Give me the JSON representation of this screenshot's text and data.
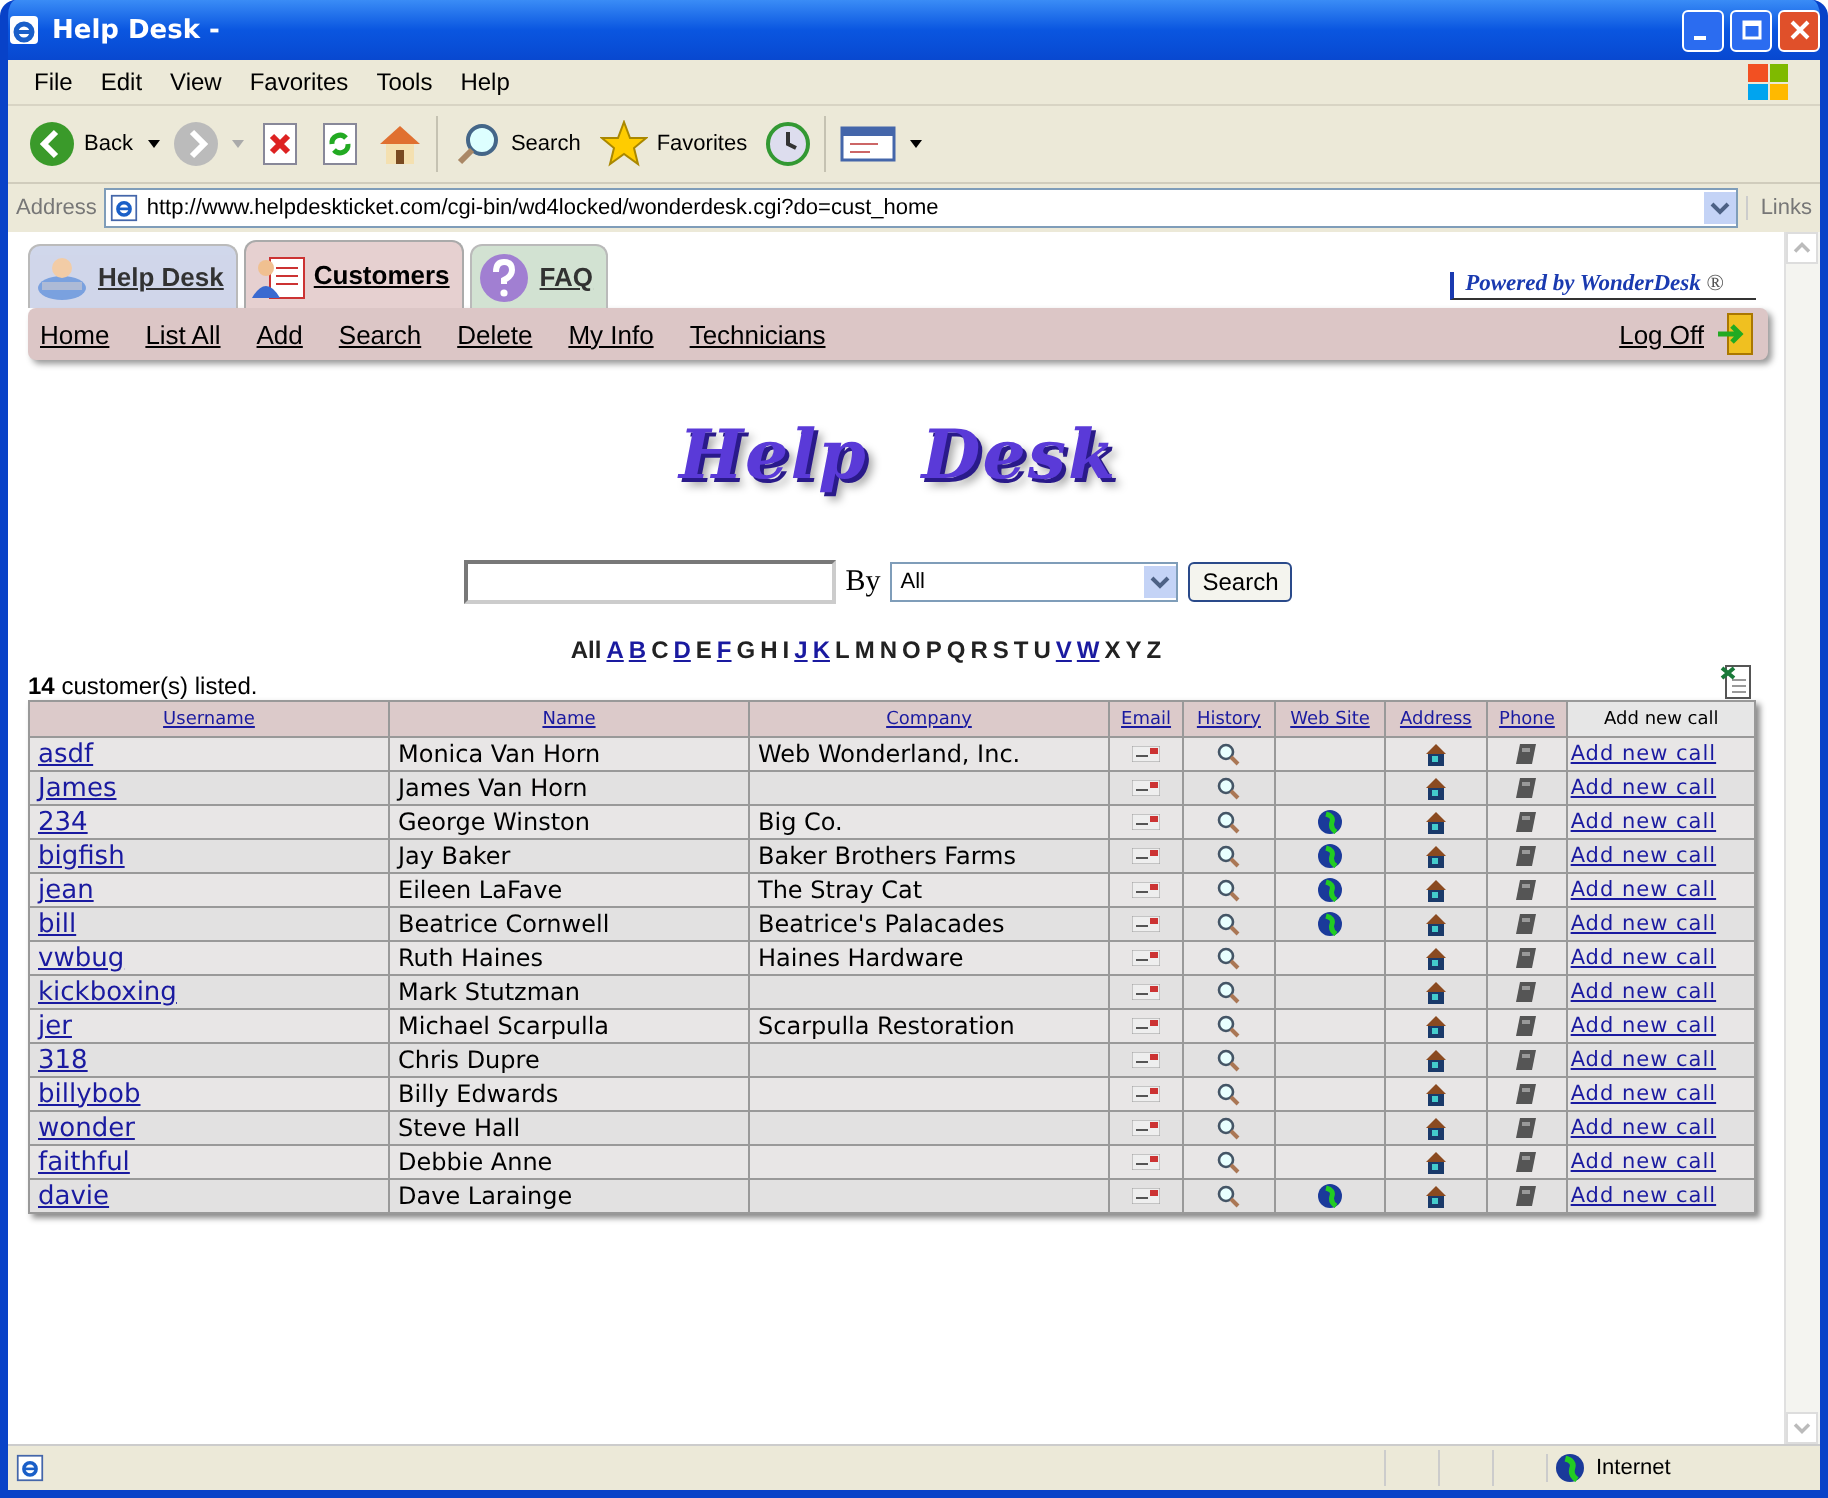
{
  "window": {
    "title": "Help Desk -"
  },
  "menu": [
    "File",
    "Edit",
    "View",
    "Favorites",
    "Tools",
    "Help"
  ],
  "toolbar": {
    "back": "Back",
    "search": "Search",
    "favorites": "Favorites"
  },
  "address": {
    "label": "Address",
    "url": "http://www.helpdeskticket.com/cgi-bin/wd4locked/wonderdesk.cgi?do=cust_home",
    "links": "Links"
  },
  "tabs": [
    {
      "label": "Help Desk",
      "selected": false,
      "kind": "helpdesk"
    },
    {
      "label": "Customers",
      "selected": true,
      "kind": "customers"
    },
    {
      "label": "FAQ",
      "selected": false,
      "kind": "faq"
    }
  ],
  "powered_by": "Powered by WonderDesk",
  "powered_mark": "®",
  "nav": [
    "Home",
    "List All",
    "Add",
    "Search",
    "Delete",
    "My Info",
    "Technicians"
  ],
  "log_off": "Log Off",
  "logo": "Help Desk",
  "search": {
    "by_label": "By",
    "by_value": "All",
    "button": "Search"
  },
  "alphabet": [
    {
      "letter": "All",
      "link": false
    },
    {
      "letter": "A",
      "link": true
    },
    {
      "letter": "B",
      "link": true
    },
    {
      "letter": "C",
      "link": false
    },
    {
      "letter": "D",
      "link": true
    },
    {
      "letter": "E",
      "link": false
    },
    {
      "letter": "F",
      "link": true
    },
    {
      "letter": "G",
      "link": false
    },
    {
      "letter": "H",
      "link": false
    },
    {
      "letter": "I",
      "link": false
    },
    {
      "letter": "J",
      "link": true
    },
    {
      "letter": "K",
      "link": true
    },
    {
      "letter": "L",
      "link": false
    },
    {
      "letter": "M",
      "link": false
    },
    {
      "letter": "N",
      "link": false
    },
    {
      "letter": "O",
      "link": false
    },
    {
      "letter": "P",
      "link": false
    },
    {
      "letter": "Q",
      "link": false
    },
    {
      "letter": "R",
      "link": false
    },
    {
      "letter": "S",
      "link": false
    },
    {
      "letter": "T",
      "link": false
    },
    {
      "letter": "U",
      "link": false
    },
    {
      "letter": "V",
      "link": true
    },
    {
      "letter": "W",
      "link": true
    },
    {
      "letter": "X",
      "link": false
    },
    {
      "letter": "Y",
      "link": false
    },
    {
      "letter": "Z",
      "link": false
    }
  ],
  "count_text": "**14** customer(s) listed.",
  "table": {
    "columns": [
      {
        "label": "Username",
        "link": true
      },
      {
        "label": "Name",
        "link": true
      },
      {
        "label": "Company",
        "link": true
      },
      {
        "label": "Email",
        "link": true
      },
      {
        "label": "History",
        "link": true
      },
      {
        "label": "Web Site",
        "link": true
      },
      {
        "label": "Address",
        "link": true
      },
      {
        "label": "Phone",
        "link": true
      },
      {
        "label": "Add new call",
        "link": false
      }
    ],
    "rows": [
      {
        "username": "asdf",
        "name": "Monica Van Horn",
        "company": "Web Wonderland, Inc.",
        "web_site": false,
        "action": "Add new call"
      },
      {
        "username": "James",
        "name": "James Van Horn",
        "web_site": false,
        "action": "Add new call"
      },
      {
        "username": "234",
        "name": "George Winston",
        "company": "Big Co.",
        "web_site": true,
        "action": "Add new call"
      },
      {
        "username": "bigfish",
        "name": "Jay Baker",
        "company": "Baker Brothers Farms",
        "web_site": true,
        "action": "Add new call"
      },
      {
        "username": "jean",
        "name": "Eileen LaFave",
        "company": "The Stray Cat",
        "web_site": true,
        "action": "Add new call"
      },
      {
        "username": "bill",
        "name": "Beatrice Cornwell",
        "company": "Beatrice's Palacades",
        "web_site": true,
        "action": "Add new call"
      },
      {
        "username": "vwbug",
        "name": "Ruth Haines",
        "company": "Haines Hardware",
        "web_site": false,
        "action": "Add new call"
      },
      {
        "username": "kickboxing",
        "name": "Mark Stutzman",
        "web_site": false,
        "action": "Add new call"
      },
      {
        "username": "jer",
        "name": "Michael Scarpulla",
        "company": "Scarpulla Restoration",
        "web_site": false,
        "action": "Add new call"
      },
      {
        "username": "318",
        "name": "Chris Dupre",
        "web_site": false,
        "action": "Add new call"
      },
      {
        "username": "billybob",
        "name": "Billy Edwards",
        "web_site": false,
        "action": "Add new call"
      },
      {
        "username": "wonder",
        "name": "Steve Hall",
        "web_site": false,
        "action": "Add new call"
      },
      {
        "username": "faithful",
        "name": "Debbie Anne",
        "web_site": false,
        "action": "Add new call"
      },
      {
        "username": "davie",
        "name": "Dave Larainge",
        "web_site": true,
        "action": "Add new call"
      }
    ]
  },
  "status_bar": {
    "zone": "Internet"
  }
}
